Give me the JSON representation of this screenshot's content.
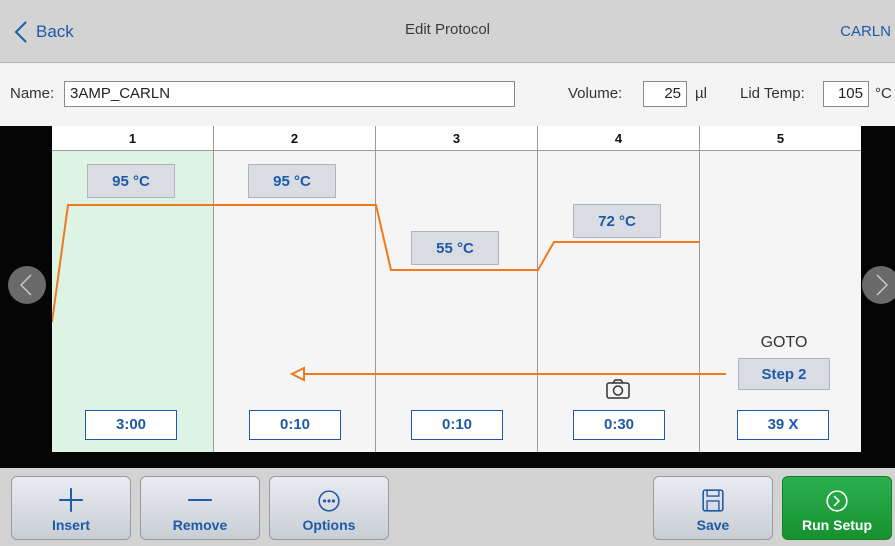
{
  "header": {
    "back_label": "Back",
    "title": "Edit Protocol",
    "user": "CARLN"
  },
  "fields": {
    "name_label": "Name:",
    "name_value": "3AMP_CARLN",
    "volume_label": "Volume:",
    "volume_value": "25",
    "volume_unit": "µl",
    "lid_label": "Lid Temp:",
    "lid_value": "105",
    "lid_unit": "°C"
  },
  "steps": [
    {
      "number": "1",
      "temp": "95 °C",
      "time": "3:00",
      "selected": true
    },
    {
      "number": "2",
      "temp": "95 °C",
      "time": "0:10",
      "selected": false
    },
    {
      "number": "3",
      "temp": "55 °C",
      "time": "0:10",
      "selected": false
    },
    {
      "number": "4",
      "temp": "72 °C",
      "time": "0:30",
      "selected": false,
      "camera_icon": "camera-icon"
    },
    {
      "number": "5",
      "goto_label": "GOTO",
      "goto_step": "Step 2",
      "cycles": "39 X",
      "selected": false
    }
  ],
  "toolbar": {
    "insert_label": "Insert",
    "remove_label": "Remove",
    "options_label": "Options",
    "save_label": "Save",
    "run_label": "Run Setup"
  },
  "icons": {
    "back": "chevron-left-icon",
    "insert": "plus-icon",
    "remove": "minus-icon",
    "options": "ellipsis-circle-icon",
    "save": "floppy-disk-icon",
    "run": "play-circle-icon",
    "nav_prev": "chevron-left-icon",
    "nav_next": "chevron-right-icon"
  },
  "colors": {
    "accent": "#1e5aa8",
    "curve": "#f07a1a",
    "selected_step": "#ddf3e4",
    "run_button": "#22a33f"
  }
}
